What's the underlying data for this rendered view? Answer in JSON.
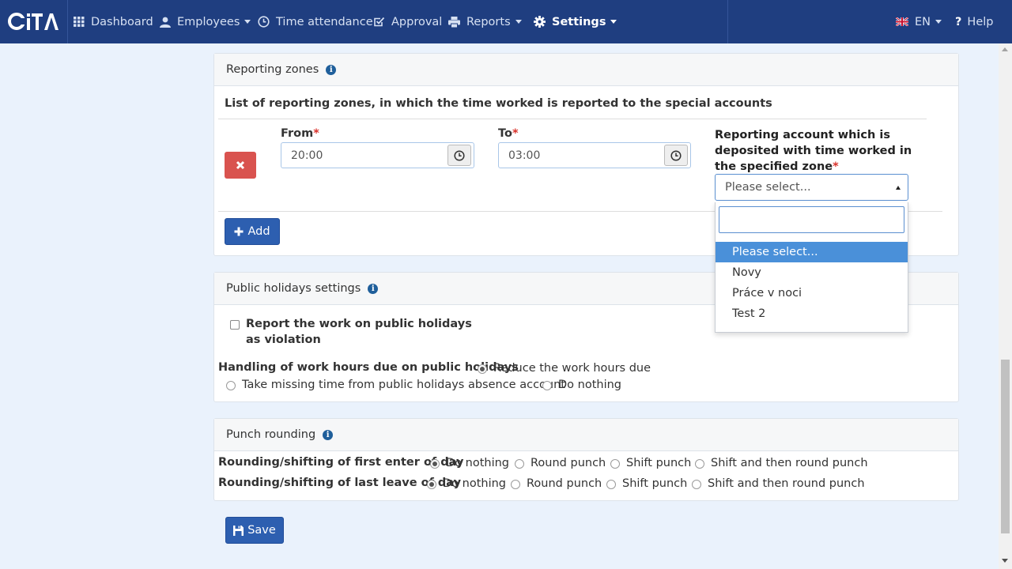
{
  "navbar": {
    "brand": "iTA",
    "items": [
      {
        "label": "Dashboard"
      },
      {
        "label": "Employees"
      },
      {
        "label": "Time attendance"
      },
      {
        "label": "Approval"
      },
      {
        "label": "Reports"
      },
      {
        "label": "Settings"
      }
    ],
    "language": "EN",
    "help": "Help"
  },
  "reporting_zones": {
    "title": "Reporting zones",
    "subtitle": "List of reporting zones, in which the time worked is reported to the special accounts",
    "from_label": "From",
    "to_label": "To",
    "from_value": "20:00",
    "to_value": "03:00",
    "account_label": "Reporting account which is deposited with time worked in the specified zone",
    "account_placeholder": "Please select...",
    "add_label": "Add",
    "dropdown_options": [
      "Please select...",
      "Novy",
      "Práce v noci",
      "Test 2"
    ]
  },
  "public_holidays": {
    "title": "Public holidays settings",
    "violation_label_1": "Report the work on public holidays",
    "violation_label_2": "as violation",
    "violation_checked": false,
    "handling_label": "Handling of work hours due on public holidays",
    "options": [
      "Reduce the work hours due",
      "Take missing time from public holidays absence account",
      "Do nothing"
    ],
    "selected": "Reduce the work hours due"
  },
  "punch_rounding": {
    "title": "Punch rounding",
    "first_label": "Rounding/shifting of first enter of day",
    "last_label": "Rounding/shifting of last leave of day",
    "options": [
      "Do nothing",
      "Round punch",
      "Shift punch",
      "Shift and then round punch"
    ],
    "first_selected": "Do nothing",
    "last_selected": "Do nothing"
  },
  "save_label": "Save",
  "colors": {
    "navbar": "#1f3e80",
    "primary": "#2d5fb0",
    "danger": "#d9534f",
    "selected_option": "#4a90d9",
    "page_bg": "#eaf2fc"
  }
}
